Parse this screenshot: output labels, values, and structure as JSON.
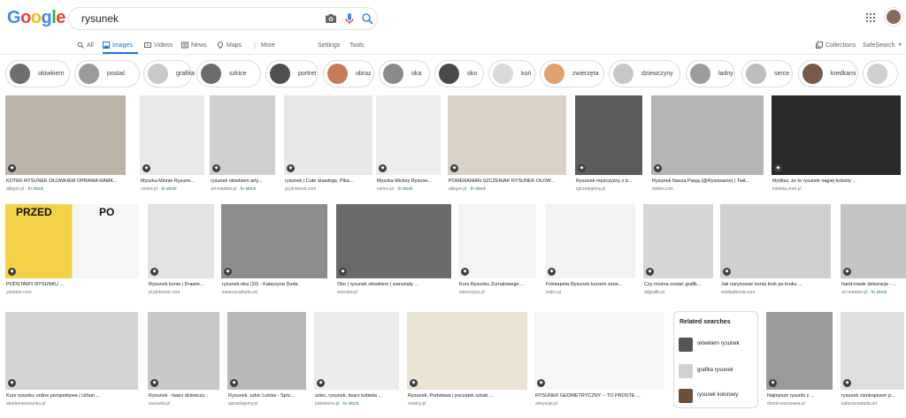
{
  "logo": {
    "letters": [
      "G",
      "o",
      "o",
      "g",
      "l",
      "e"
    ],
    "colors": [
      "#4285f4",
      "#ea4335",
      "#fbbc05",
      "#4285f4",
      "#34a853",
      "#ea4335"
    ]
  },
  "search": {
    "query": "rysunek"
  },
  "nav": {
    "tabs": [
      "All",
      "Images",
      "Videos",
      "News",
      "Maps",
      "More"
    ],
    "settings": "Settings",
    "tools": "Tools",
    "collections": "Collections",
    "safesearch": "SafeSearch"
  },
  "chips": [
    {
      "label": "ołówkiem",
      "tone": "#6e6e6e"
    },
    {
      "label": "postać",
      "tone": "#9a9a9a"
    },
    {
      "label": "grafika",
      "tone": "#c9c9c9"
    },
    {
      "label": "szkice",
      "tone": "#6c6c6c"
    },
    {
      "label": "portret",
      "tone": "#505050"
    },
    {
      "label": "obraz",
      "tone": "#c77b58"
    },
    {
      "label": "oka",
      "tone": "#8a8a8a"
    },
    {
      "label": "oko",
      "tone": "#4a4a4a"
    },
    {
      "label": "koń",
      "tone": "#d9d9d9"
    },
    {
      "label": "zwierzęta",
      "tone": "#e0a070"
    },
    {
      "label": "dziewczyny",
      "tone": "#c8c8c8"
    },
    {
      "label": "ładny",
      "tone": "#9c9c9c"
    },
    {
      "label": "serce",
      "tone": "#bdbdbd"
    },
    {
      "label": "kredkami",
      "tone": "#7a5a4a"
    },
    {
      "label": "",
      "tone": "#cfcfcf"
    }
  ],
  "row1": [
    {
      "caption": "KOTEK RYSUNEK OŁÓWKIEM OPRAWA RAMK...",
      "source": "allegro.pl",
      "stock": "In stock",
      "tone": "#bdb4a8"
    },
    {
      "caption": "Myszka Minnie Rysune...",
      "source": "ceneo.pl",
      "stock": "In stock",
      "tone": "#e9e9e9"
    },
    {
      "caption": "rysunek ołówkiem arty...",
      "source": "art-madam.pl",
      "stock": "In stock",
      "tone": "#cfcfcf"
    },
    {
      "caption": "rysunek | Cute drawings, Pika...",
      "source": "pl.pinterest.com",
      "stock": "",
      "tone": "#e8e8e8"
    },
    {
      "caption": "Myszka Mickey Rysune...",
      "source": "ceneo.pl",
      "stock": "In stock",
      "tone": "#ededed"
    },
    {
      "caption": "POMERANIAN SZCZENIAK RYSUNEK OŁÓW...",
      "source": "allegro.pl",
      "stock": "In stock",
      "tone": "#d8d2c6"
    },
    {
      "caption": "Rysunek mężczyzny z b...",
      "source": "sprzedajemy.pl",
      "stock": "",
      "tone": "#5c5c5c"
    },
    {
      "caption": "Rysunek Naszą Pasją (@Rysowanie) | Twit...",
      "source": "twitter.com",
      "stock": "",
      "tone": "#b5b5b5"
    },
    {
      "caption": "Myślisz, że to rysunek nagiej kobiety ...",
      "source": "kobieta.onet.pl",
      "stock": "",
      "tone": "#2a2a2a"
    }
  ],
  "row2": [
    {
      "caption": "PODSTAWY RYSUNKU ...",
      "source": "youtube.com",
      "stock": "",
      "tone": "#f0e08a",
      "before": "PRZED",
      "after": "PO"
    },
    {
      "caption": "Rysunek konia | Drawin...",
      "source": "pl.pinterest.com",
      "stock": "",
      "tone": "#e2e2e2"
    },
    {
      "caption": "rysunek-oka (10) - Katarzyna Duda",
      "source": "katarzynaduda.art",
      "stock": "",
      "tone": "#8d8d8d"
    },
    {
      "caption": "Oko | rysunek ołówkiem | warsztaty ...",
      "source": "wroclaw.pl",
      "stock": "",
      "tone": "#6a6a6a"
    },
    {
      "caption": "Kurs Rysunku Żurnalowego ...",
      "source": "wenecjusz.pl",
      "stock": "",
      "tone": "#f4f4f4"
    },
    {
      "caption": "Fototapeta Rysunek tuszem zerw...",
      "source": "redro.pl",
      "stock": "",
      "tone": "#f2f2f2"
    },
    {
      "caption": "Czy można zostać grafik...",
      "source": "ddgrafik.pl",
      "stock": "",
      "tone": "#d6d6d6"
    },
    {
      "caption": "Jak narysować konia krok po kroku ...",
      "source": "artakademia.com",
      "stock": "",
      "tone": "#cfcfcf"
    },
    {
      "caption": "hand-made dekoracje - ...",
      "source": "art-madam.pl",
      "stock": "In stock",
      "tone": "#c4c4c4"
    }
  ],
  "row3": [
    {
      "caption": "Kurs rysunku online perspektywa | Urban ...",
      "source": "akademiarysunku.pl",
      "stock": "",
      "tone": "#d4d4d4"
    },
    {
      "caption": "Rysunek - twarz dziewczy...",
      "source": "zszywka.pl",
      "stock": "",
      "tone": "#c8c8c8"
    },
    {
      "caption": "Rysunek, szkic Luków - Sprz...",
      "source": "sprzedajemy.pl",
      "stock": "",
      "tone": "#b8b8b8"
    },
    {
      "caption": "szkic, rysunek, twarz kobieta ...",
      "source": "pakamera.pl",
      "stock": "In stock",
      "tone": "#ececec"
    },
    {
      "caption": "Rysunek. Podstawa i początek sztuki ...",
      "source": "nowiny.pl",
      "stock": "",
      "tone": "#e9e3d2"
    },
    {
      "caption": "RYSUNEK GEOMETRYCZNY -- TO PROSTE ...",
      "source": "sierysuje.pl",
      "stock": "",
      "tone": "#f6f6f6"
    },
    {
      "caption": "Najlepsze rysunki z ...",
      "source": "domin-warszawa.pl",
      "stock": "",
      "tone": "#9a9a9a"
    },
    {
      "caption": "rysunek cienkopisem p...",
      "source": "katarzynaduda.art",
      "stock": "",
      "tone": "#dedede"
    }
  ],
  "related": {
    "title": "Related searches",
    "items": [
      {
        "label": "ołówkiem rysunek",
        "tone": "#555555"
      },
      {
        "label": "grafika rysunek",
        "tone": "#d0d0d0"
      },
      {
        "label": "rysunek kolorowy",
        "tone": "#6b4f3a"
      }
    ]
  }
}
